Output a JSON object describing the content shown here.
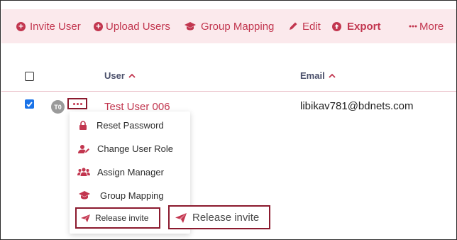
{
  "toolbar": {
    "invite_user": "Invite User",
    "upload_users": "Upload Users",
    "group_mapping": "Group Mapping",
    "edit": "Edit",
    "export": "Export",
    "more": "More"
  },
  "table": {
    "columns": {
      "user": "User",
      "email": "Email"
    },
    "rows": [
      {
        "avatar": "T0",
        "name": "Test User 006",
        "email": "libikav781@bdnets.com",
        "checked": true
      }
    ]
  },
  "row_menu": {
    "items": [
      "Reset Password",
      "Change User Role",
      "Assign Manager",
      "Group Mapping",
      "Release invite"
    ]
  },
  "callout": {
    "label": "Release invite"
  },
  "colors": {
    "accent": "#c2364f",
    "toolbar_bg": "#fbe9ec",
    "highlight_border": "#8b1a2e"
  }
}
